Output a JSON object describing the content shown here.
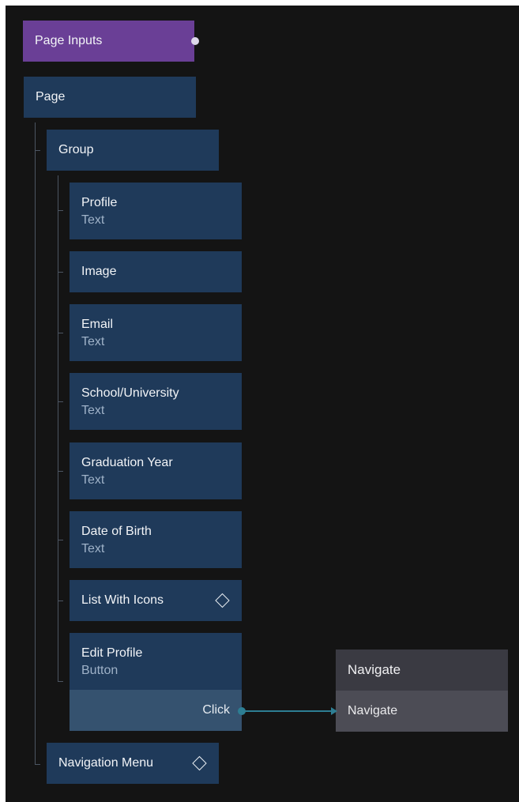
{
  "page_inputs": {
    "label": "Page Inputs"
  },
  "page": {
    "label": "Page"
  },
  "group": {
    "label": "Group"
  },
  "children": [
    {
      "title": "Profile",
      "type": "Text"
    },
    {
      "title": "Image"
    },
    {
      "title": "Email",
      "type": "Text"
    },
    {
      "title": "School/University",
      "type": "Text"
    },
    {
      "title": "Graduation Year",
      "type": "Text"
    },
    {
      "title": "Date of Birth",
      "type": "Text"
    },
    {
      "title": "List With Icons",
      "icon": "diamond-icon"
    },
    {
      "title": "Edit Profile",
      "type": "Button",
      "output_port": "Click"
    }
  ],
  "navigation_menu": {
    "label": "Navigation Menu",
    "icon": "diamond-icon"
  },
  "navigate_node": {
    "title": "Navigate",
    "input_port": "Navigate"
  },
  "colors": {
    "canvas": "#141414",
    "node": "#1f3a5a",
    "node_port_row": "#35526f",
    "inputs_node": "#6a3f96",
    "navigate_node": "#3a3a42",
    "navigate_port_row": "#4c4c55",
    "wire": "#2d7e93"
  }
}
